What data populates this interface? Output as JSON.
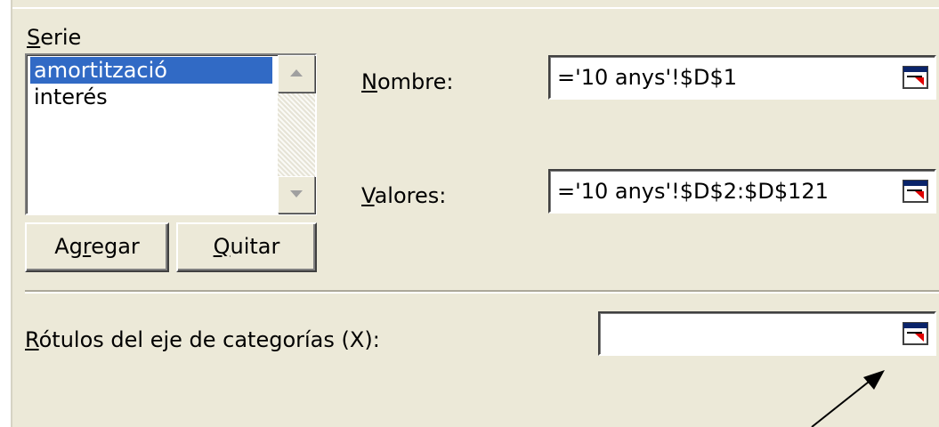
{
  "serie": {
    "label_prefix": "",
    "label_ul": "S",
    "label_rest": "erie",
    "items": [
      "amortització",
      "interés"
    ],
    "selected_index": 0
  },
  "nombre": {
    "label_ul": "N",
    "label_rest": "ombre:",
    "value": "='10 anys'!$D$1"
  },
  "valores": {
    "label_ul": "V",
    "label_rest": "alores:",
    "value": "='10 anys'!$D$2:$D$121"
  },
  "buttons": {
    "agregar": {
      "pre": "Ag",
      "ul": "r",
      "post": "egar"
    },
    "quitar": {
      "pre": "",
      "ul": "Q",
      "post": "uitar"
    }
  },
  "categorias": {
    "label_ul": "R",
    "label_rest": "ótulos del eje de categorías (X):",
    "value": ""
  },
  "icons": {
    "collapse": "collapse-dialog-icon",
    "scroll_up": "scroll-up-arrow-icon",
    "scroll_down": "scroll-down-arrow-icon",
    "pointer_arrow": "annotation-arrow-icon"
  },
  "colors": {
    "selection": "#316AC5",
    "dialog_bg": "#ECE9D8"
  }
}
